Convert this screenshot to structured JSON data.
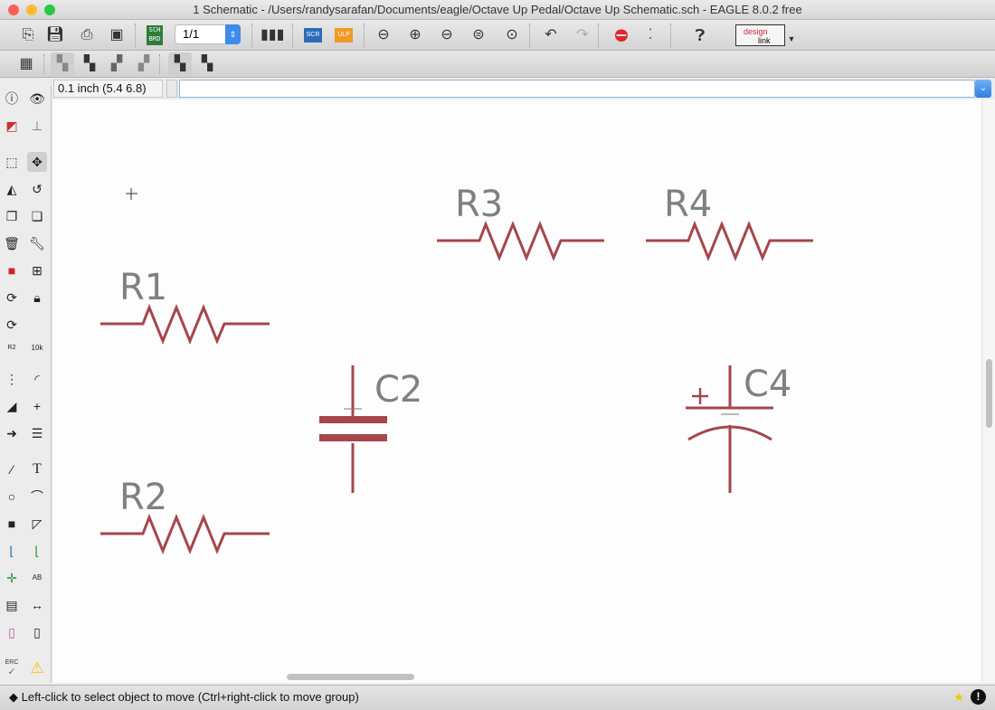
{
  "window": {
    "title": "1 Schematic - /Users/randysarafan/Documents/eagle/Octave Up Pedal/Octave Up Schematic.sch - EAGLE 8.0.2 free"
  },
  "toolbar": {
    "sheet_value": "1/1",
    "sch_brd_top": "SCH",
    "sch_brd_bottom": "BRD",
    "scr_label": "SCR",
    "ulp_label": "ULP",
    "designlink_top": "design",
    "designlink_bottom": "link"
  },
  "command_bar": {
    "grid_readout": "0.1 inch (5.4 6.8)",
    "command_value": ""
  },
  "left_toolbar": {
    "name_label": "R2",
    "value_label": "10k",
    "erc_label": "ERC",
    "text_tool": "T"
  },
  "schematic": {
    "parts": [
      {
        "name": "R3"
      },
      {
        "name": "R4"
      },
      {
        "name": "R1"
      },
      {
        "name": "C2"
      },
      {
        "name": "C4"
      },
      {
        "name": "R2"
      }
    ],
    "part_color": "#a5474b",
    "label_color": "#808080"
  },
  "status": {
    "message": "Left-click to select object to move (Ctrl+right-click to move group)"
  }
}
